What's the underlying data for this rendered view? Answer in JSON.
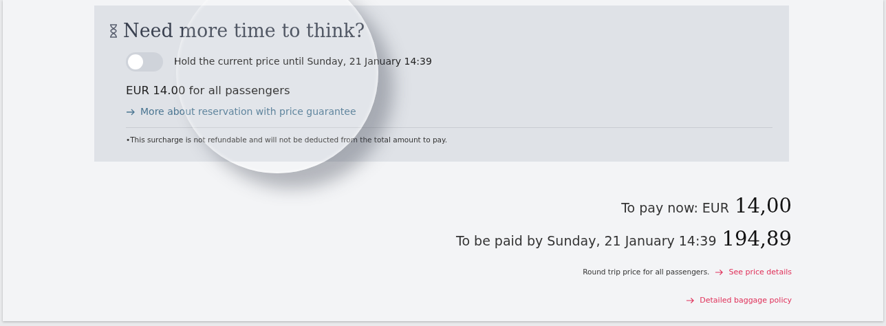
{
  "hold_panel": {
    "title": "Need more time to think?",
    "toggle": {
      "on": false,
      "label": "Hold the current price until Sunday, 21 January 14:39"
    },
    "fee": "EUR 14.00 for all passengers",
    "more_link": "More about reservation with price guarantee",
    "footnote": "•This surcharge is not refundable and will not be deducted from the total amount to pay."
  },
  "summary": {
    "pay_now": {
      "label": "To pay now: EUR",
      "amount": "14,00"
    },
    "pay_later": {
      "label": "To be paid by Sunday, 21 January 14:39",
      "amount": "194,89"
    },
    "note": "Round trip price for all passengers.",
    "price_link": "See price details",
    "baggage_link": "Detailed baggage policy"
  }
}
